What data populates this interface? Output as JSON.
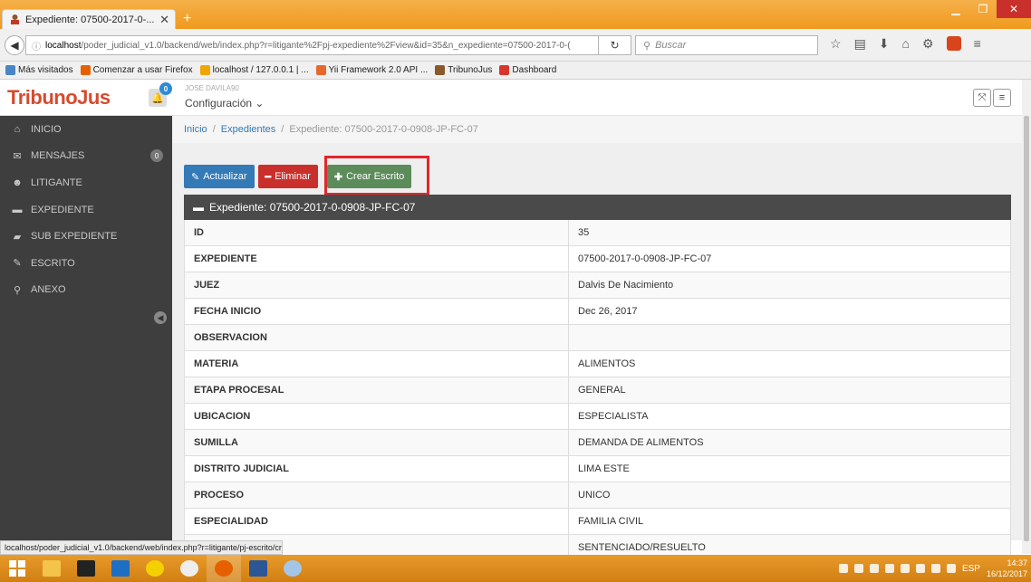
{
  "browser": {
    "tab_title": "Expediente: 07500-2017-0-...",
    "tab_close": "✕",
    "new_tab": "+",
    "url_host": "localhost",
    "url_rest": "/poder_judicial_v1.0/backend/web/index.php?r=litigante%2Fpj-expediente%2Fview&id=35&n_expediente=07500-2017-0-(",
    "search_placeholder": "Buscar",
    "bookmarks": [
      {
        "label": "Más visitados",
        "color": "#4a86c5"
      },
      {
        "label": "Comenzar a usar Firefox",
        "color": "#e66000"
      },
      {
        "label": "localhost / 127.0.0.1 | ...",
        "color": "#f0a500"
      },
      {
        "label": "Yii Framework 2.0 API ...",
        "color": "#e6682d"
      },
      {
        "label": "TribunoJus",
        "color": "#8a5a2b"
      },
      {
        "label": "Dashboard",
        "color": "#d9362b"
      }
    ],
    "status_url": "localhost/poder_judicial_v1.0/backend/web/index.php?r=litigante/pj-escrito/create&temp=35&tipo=expediente"
  },
  "app": {
    "brand": "TribunoJus",
    "notif_count": "0",
    "username": "JOSE DAVILA90",
    "config_label": "Configuración ⌄"
  },
  "sidebar": {
    "items": [
      {
        "label": "INICIO",
        "icon": "home-icon",
        "glyph": "⌂"
      },
      {
        "label": "MENSAJES",
        "icon": "envelope-icon",
        "glyph": "✉",
        "badge": "0"
      },
      {
        "label": "LITIGANTE",
        "icon": "user-icon",
        "glyph": "☻"
      },
      {
        "label": "EXPEDIENTE",
        "icon": "folder-icon",
        "glyph": "▬"
      },
      {
        "label": "SUB EXPEDIENTE",
        "icon": "folder-open-icon",
        "glyph": "▰"
      },
      {
        "label": "ESCRITO",
        "icon": "edit-icon",
        "glyph": "✎"
      },
      {
        "label": "ANEXO",
        "icon": "paperclip-icon",
        "glyph": "⚲"
      }
    ]
  },
  "breadcrumb": {
    "home": "Inicio",
    "sep": "/",
    "section": "Expedientes",
    "current": "Expediente: 07500-2017-0-0908-JP-FC-07"
  },
  "actions": {
    "update": "Actualizar",
    "delete": "Eliminar",
    "create": "Crear Escrito"
  },
  "panel_title": "Expediente: 07500-2017-0-0908-JP-FC-07",
  "details": [
    {
      "key": "ID",
      "value": "35"
    },
    {
      "key": "EXPEDIENTE",
      "value": "07500-2017-0-0908-JP-FC-07"
    },
    {
      "key": "JUEZ",
      "value": "Dalvis De Nacimiento"
    },
    {
      "key": "FECHA INICIO",
      "value": "Dec 26, 2017"
    },
    {
      "key": "OBSERVACION",
      "value": ""
    },
    {
      "key": "MATERIA",
      "value": "ALIMENTOS"
    },
    {
      "key": "ETAPA PROCESAL",
      "value": "GENERAL"
    },
    {
      "key": "UBICACION",
      "value": "ESPECIALISTA"
    },
    {
      "key": "SUMILLA",
      "value": "DEMANDA DE ALIMENTOS"
    },
    {
      "key": "DISTRITO JUDICIAL",
      "value": "LIMA ESTE"
    },
    {
      "key": "PROCESO",
      "value": "UNICO"
    },
    {
      "key": "ESPECIALIDAD",
      "value": "FAMILIA CIVIL"
    },
    {
      "key": "",
      "value": "SENTENCIADO/RESUELTO"
    }
  ],
  "taskbar": {
    "lang": "ESP",
    "time": "14:37",
    "date": "16/12/2017"
  },
  "colors": {
    "accent_orange": "#ef9a1e",
    "brand_red": "#d54b2f",
    "highlight_red": "#e3262c"
  }
}
